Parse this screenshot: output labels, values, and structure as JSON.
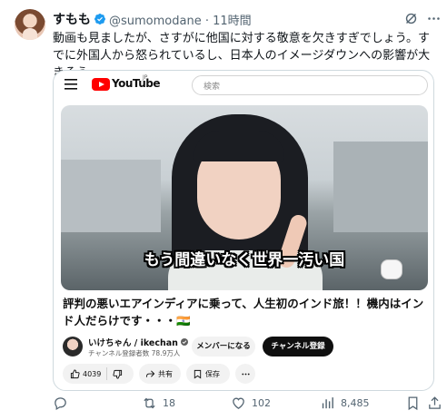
{
  "tweet": {
    "display_name": "すもも",
    "handle_time": "@sumomodane · 11時間",
    "text": "動画も見ましたが、さすがに他国に対する敬意を欠きすぎでしょう。すでに外国人から怒られているし、日本人のイメージダウンへの影響が大きそう。",
    "verified_color": "#1d9bf0"
  },
  "card": {
    "youtube": {
      "wordmark": "YouTube",
      "region": "JP",
      "search_placeholder": "検索"
    },
    "video": {
      "caption": "もう間違いなく世界一汚い国",
      "title": "評判の悪いエアインディアに乗って、人生初のインド旅！！機内はインド人だらけです・・・🇮🇳"
    },
    "channel": {
      "name": "いけちゃん / ikechan",
      "subscribers": "チャンネル登録者数 78.9万人",
      "member_button": "メンバーになる",
      "subscribe_button": "チャンネル登録"
    },
    "video_actions": {
      "likes": "4039",
      "share": "共有",
      "save": "保存"
    }
  },
  "actions": {
    "replies": "",
    "retweets": "18",
    "likes": "102",
    "views": "8,485"
  },
  "icons": [
    "grok-icon",
    "more-icon",
    "reply-icon",
    "retweet-icon",
    "like-icon",
    "views-icon",
    "bookmark-icon",
    "share-icon"
  ]
}
